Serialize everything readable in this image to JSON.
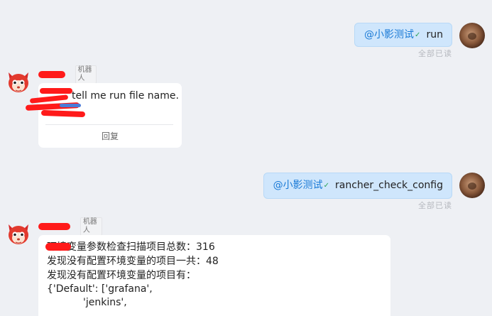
{
  "messages": {
    "out1": {
      "mention": "@小影测试",
      "text": "run",
      "status": "全部已读"
    },
    "in1": {
      "sender_tag": "机器人",
      "text": "tell me run file name.",
      "reply_label": "回复"
    },
    "out2": {
      "mention": "@小影测试",
      "text": "rancher_check_config",
      "status": "全部已读"
    },
    "in2": {
      "sender_tag": "机器人",
      "lines": [
        "环境变量参数检查扫描项目总数：316",
        "发现没有配置环境变量的项目一共：48",
        "发现没有配置环境变量的项目有：",
        "{'Default': ['grafana',",
        "'jenkins',"
      ]
    }
  },
  "colors": {
    "background": "#eef0f4",
    "outgoing_bubble": "#cfe6fc",
    "mention": "#1a7ad6",
    "redaction": "#ff1a1a",
    "verified": "#2aa35a"
  },
  "icons": {
    "verified": "check-icon",
    "bot_avatar": "fox-avatar-icon",
    "user_avatar": "user-avatar"
  }
}
